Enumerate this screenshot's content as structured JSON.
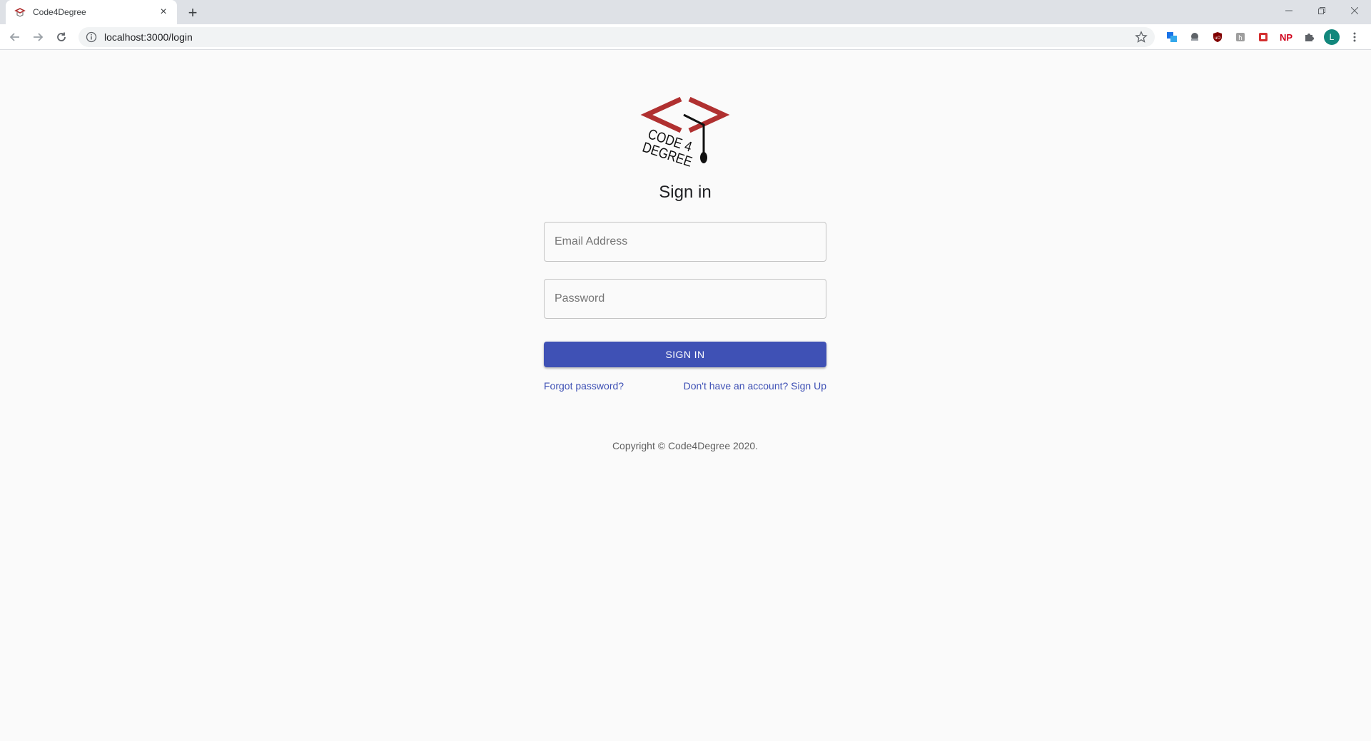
{
  "browser": {
    "tab_title": "Code4Degree",
    "tab_close": "×",
    "new_tab": "+",
    "url": "localhost:3000/login",
    "profile_initial": "L",
    "np_extension": "NP",
    "window_controls": {
      "minimize": "—",
      "restore": "❐",
      "close": "✕"
    }
  },
  "logo": {
    "text_line1": "CODE 4",
    "text_line2": "DEGREE",
    "colors": {
      "brackets": "#b03030",
      "ink": "#111111"
    }
  },
  "login": {
    "title": "Sign in",
    "email_placeholder": "Email Address",
    "password_placeholder": "Password",
    "submit_label": "SIGN IN",
    "forgot_link": "Forgot password?",
    "signup_link": "Don't have an account? Sign Up"
  },
  "footer": {
    "copyright": "Copyright © Code4Degree 2020."
  },
  "colors": {
    "primary": "#3f51b5",
    "background": "#fafafa"
  }
}
